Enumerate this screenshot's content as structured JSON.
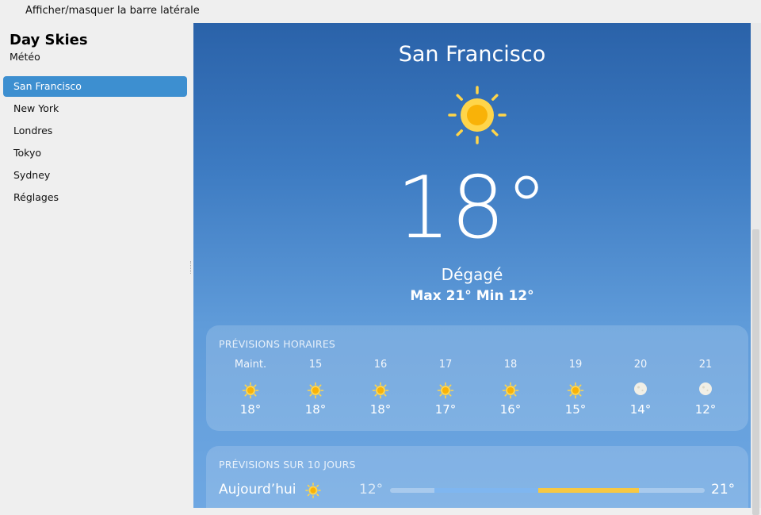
{
  "topbar": {
    "toggle_sidebar_label": "Afficher/masquer la barre latérale"
  },
  "sidebar": {
    "title": "Day Skies",
    "subtitle": "Météo",
    "items": [
      {
        "label": "San Francisco",
        "active": true
      },
      {
        "label": "New York",
        "active": false
      },
      {
        "label": "Londres",
        "active": false
      },
      {
        "label": "Tokyo",
        "active": false
      },
      {
        "label": "Sydney",
        "active": false
      },
      {
        "label": "Réglages",
        "active": false
      }
    ]
  },
  "current": {
    "city": "San Francisco",
    "icon": "sun-icon",
    "temperature": "18°",
    "condition": "Dégagé",
    "high_low": "Max 21° Min 12°"
  },
  "hourly": {
    "title": "PRÉVISIONS HORAIRES",
    "hours": [
      {
        "time": "Maint.",
        "icon": "sun-icon",
        "temp": "18°"
      },
      {
        "time": "15",
        "icon": "sun-icon",
        "temp": "18°"
      },
      {
        "time": "16",
        "icon": "sun-icon",
        "temp": "18°"
      },
      {
        "time": "17",
        "icon": "sun-icon",
        "temp": "17°"
      },
      {
        "time": "18",
        "icon": "sun-icon",
        "temp": "16°"
      },
      {
        "time": "19",
        "icon": "sun-icon",
        "temp": "15°"
      },
      {
        "time": "20",
        "icon": "moon-icon",
        "temp": "14°"
      },
      {
        "time": "21",
        "icon": "moon-icon",
        "temp": "12°"
      }
    ]
  },
  "daily": {
    "title": "PRÉVISIONS SUR 10 JOURS",
    "days": [
      {
        "day": "Aujourd’hui",
        "icon": "sun-icon",
        "low": "12°",
        "high": "21°",
        "range_start": 0.14,
        "current_point": 0.47,
        "range_end": 0.79
      }
    ]
  },
  "colors": {
    "sidebar_active": "#3d8fd0",
    "sun": "#f9b208",
    "sun_ray": "#ffd54a",
    "moon": "#f1efe6",
    "range_cool": "#7fb6f0",
    "range_warm": "#f7c843"
  }
}
